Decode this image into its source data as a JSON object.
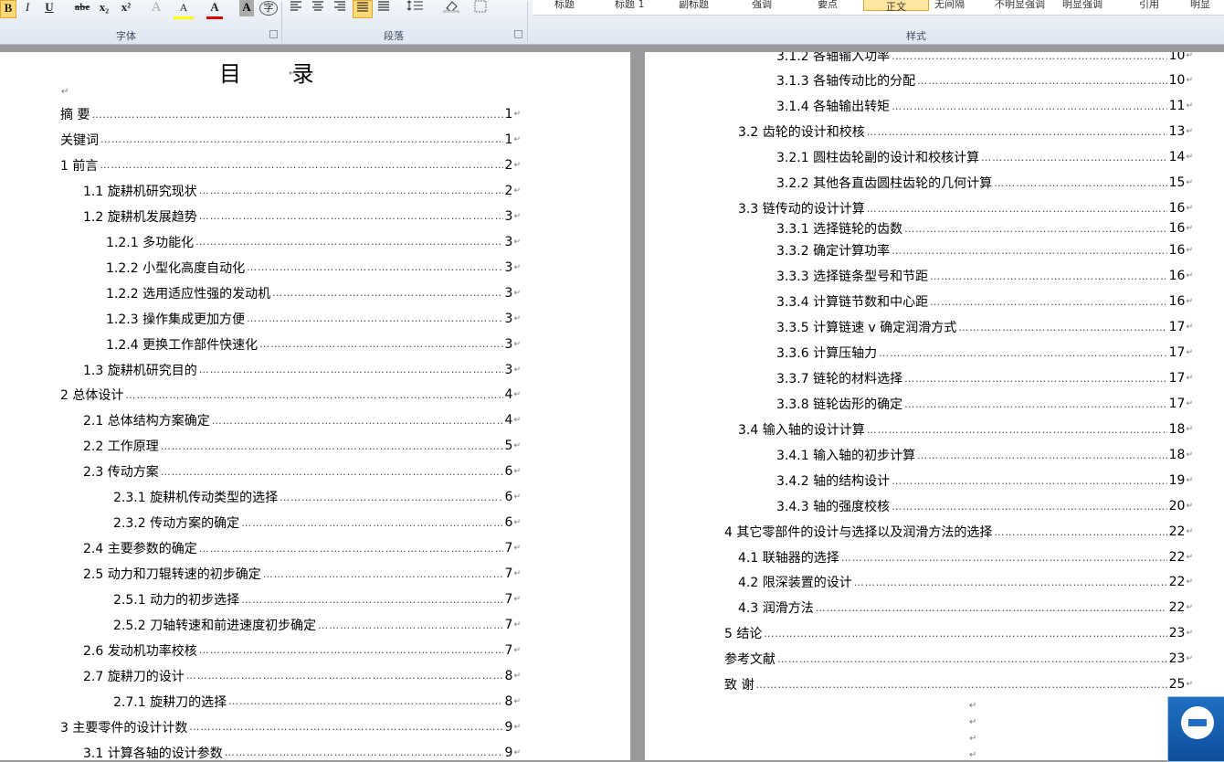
{
  "ribbon": {
    "format_buttons": [
      "B",
      "I",
      "U",
      "abe",
      "x₂",
      "x²",
      "A",
      "A",
      "A",
      "字"
    ],
    "para_icons": [
      "align-left",
      "align-center",
      "align-right",
      "justify",
      "distribute",
      "line-spacing",
      "shading",
      "borders"
    ],
    "styles": [
      "标题",
      "标题 1",
      "副标题",
      "强调",
      "要点",
      "正文",
      "无间隔",
      "不明显强调",
      "明显强调",
      "引用",
      "明显"
    ],
    "active_style_index": 5,
    "groups": {
      "font": "字体",
      "paragraph": "段落",
      "styles": "样式"
    }
  },
  "left_page": {
    "title": "目  录",
    "entries": [
      {
        "text": "摘  要",
        "page": "1",
        "indent": 0
      },
      {
        "text": "关键词",
        "page": "1",
        "indent": 0
      },
      {
        "text": "1 前言",
        "page": "2",
        "indent": 0
      },
      {
        "text": "1.1 旋耕机研究现状",
        "page": "2",
        "indent": 1
      },
      {
        "text": "1.2 旋耕机发展趋势",
        "page": "3",
        "indent": 1
      },
      {
        "text": "1.2.1 多功能化",
        "page": "3",
        "indent": 2
      },
      {
        "text": "1.2.2 小型化高度自动化",
        "page": "3",
        "indent": 2
      },
      {
        "text": "1.2.2 选用适应性强的发动机",
        "page": "3",
        "indent": 2
      },
      {
        "text": "1.2.3 操作集成更加方便",
        "page": "3",
        "indent": 2
      },
      {
        "text": "1.2.4 更换工作部件快速化",
        "page": "3",
        "indent": 2
      },
      {
        "text": "1.3 旋耕机研究目的",
        "page": "3",
        "indent": 1
      },
      {
        "text": "2 总体设计",
        "page": "4",
        "indent": 0
      },
      {
        "text": "2.1 总体结构方案确定",
        "page": "4",
        "indent": 1
      },
      {
        "text": "2.2 工作原理",
        "page": "5",
        "indent": 1
      },
      {
        "text": "2.3 传动方案",
        "page": "6",
        "indent": 1
      },
      {
        "text": "2.3.1 旋耕机传动类型的选择",
        "page": "6",
        "indent": 3
      },
      {
        "text": "2.3.2 传动方案的确定",
        "page": "6",
        "indent": 3
      },
      {
        "text": "2.4 主要参数的确定",
        "page": "7",
        "indent": 1
      },
      {
        "text": "2.5 动力和刀辊转速的初步确定",
        "page": "7",
        "indent": 1
      },
      {
        "text": "2.5.1 动力的初步选择",
        "page": "7",
        "indent": 3
      },
      {
        "text": "2.5.2 刀轴转速和前进速度初步确定",
        "page": "7",
        "indent": 3
      },
      {
        "text": "2.6 发动机功率校核",
        "page": "7",
        "indent": 1
      },
      {
        "text": "2.7 旋耕刀的设计",
        "page": "8",
        "indent": 1
      },
      {
        "text": "2.7.1 旋耕刀的选择",
        "page": "8",
        "indent": 3
      },
      {
        "text": "3 主要零件的设计计数",
        "page": "9",
        "indent": 0
      },
      {
        "text": "3.1 计算各轴的设计参数",
        "page": "9",
        "indent": 1
      }
    ]
  },
  "right_page": {
    "entries": [
      {
        "text": "3.1.2 各轴输入功率",
        "page": "10",
        "indent": 2
      },
      {
        "text": "3.1.3 各轴传动比的分配",
        "page": "10",
        "indent": 2
      },
      {
        "text": "3.1.4 各轴输出转矩",
        "page": "11",
        "indent": 2
      },
      {
        "text": "3.2 齿轮的设计和校核",
        "page": "13",
        "indent": 1
      },
      {
        "text": "3.2.1 圆柱齿轮副的设计和校核计算",
        "page": "14",
        "indent": 2
      },
      {
        "text": "3.2.2 其他各直齿圆柱齿轮的几何计算",
        "page": "15",
        "indent": 2
      },
      {
        "text": "3.3  链传动的设计计算",
        "page": "16",
        "indent": 1
      },
      {
        "text": "3.3.1 选择链轮的齿数",
        "page": "16",
        "indent": 2
      },
      {
        "text": "3.3.2 确定计算功率",
        "page": "16",
        "indent": 2
      },
      {
        "text": "3.3.3 选择链条型号和节距",
        "page": "16",
        "indent": 2
      },
      {
        "text": "3.3.4 计算链节数和中心距",
        "page": "16",
        "indent": 2
      },
      {
        "text": "3.3.5 计算链速 v 确定润滑方式",
        "page": "17",
        "indent": 2
      },
      {
        "text": "3.3.6 计算压轴力",
        "page": "17",
        "indent": 2
      },
      {
        "text": "3.3.7 链轮的材料选择",
        "page": "17",
        "indent": 2
      },
      {
        "text": "3.3.8 链轮齿形的确定",
        "page": "17",
        "indent": 2
      },
      {
        "text": "3.4 输入轴的设计计算",
        "page": "18",
        "indent": 1
      },
      {
        "text": "3.4.1 输入轴的初步计算",
        "page": "18",
        "indent": 2
      },
      {
        "text": "3.4.2 轴的结构设计",
        "page": "19",
        "indent": 2
      },
      {
        "text": "3.4.3 轴的强度校核",
        "page": "20",
        "indent": 2
      },
      {
        "text": "4 其它零部件的设计与选择以及润滑方法的选择",
        "page": "22",
        "indent": 0
      },
      {
        "text": "4.1  联轴器的选择",
        "page": "22",
        "indent": 1
      },
      {
        "text": "4.2  限深装置的设计",
        "page": "22",
        "indent": 1
      },
      {
        "text": "4.3  润滑方法",
        "page": "22",
        "indent": 1
      },
      {
        "text": "5 结论",
        "page": "23",
        "indent": 0
      },
      {
        "text": "参考文献",
        "page": "23",
        "indent": 0
      },
      {
        "text": "致  谢",
        "page": "25",
        "indent": 0
      }
    ]
  },
  "leader": "………………………………………………………………………………………………………………………………………………",
  "para_mark": "↵",
  "colors": {
    "highlight": "#ffff00",
    "font_red": "#e00000",
    "active_style": "#ffe7a2"
  }
}
